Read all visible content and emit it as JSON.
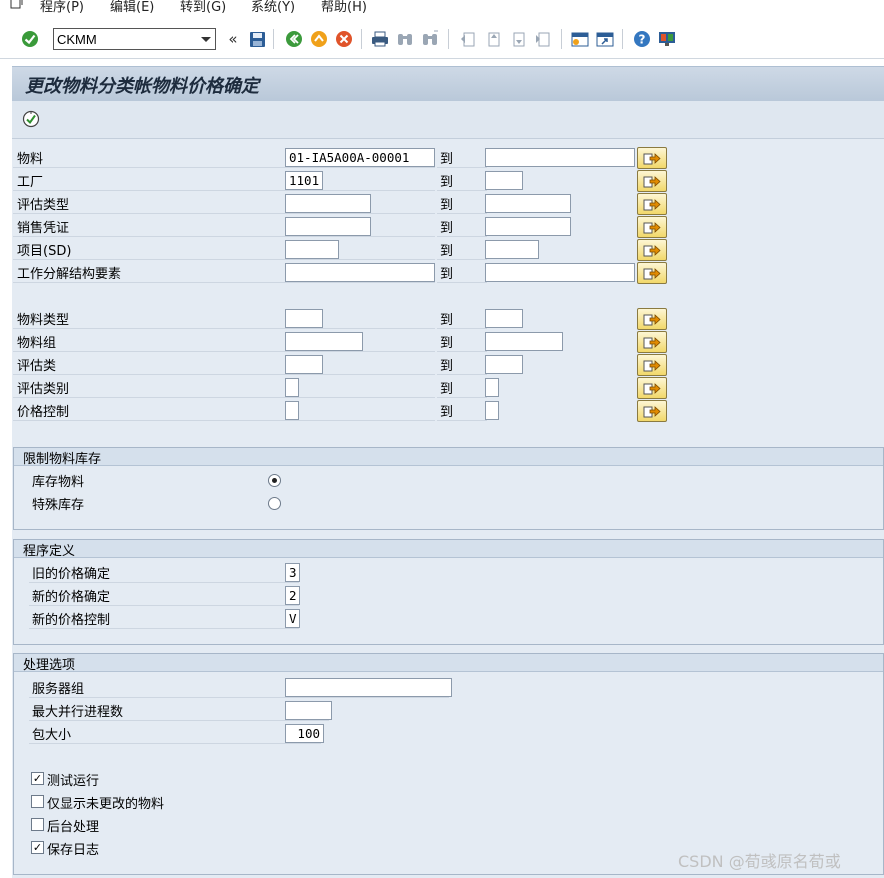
{
  "menu": [
    "程序(P)",
    "编辑(E)",
    "转到(G)",
    "系统(Y)",
    "帮助(H)"
  ],
  "toolbar": {
    "command_value": "CKMM",
    "icons": [
      "ok-icon",
      "back-double-icon",
      "save-icon",
      "back-icon",
      "exit-icon",
      "cancel-icon",
      "print-icon",
      "find-icon",
      "find-next-icon",
      "first-page-icon",
      "prev-page-icon",
      "next-page-icon",
      "last-page-icon",
      "new-session-icon",
      "shortcut-icon",
      "help-icon",
      "layout-icon"
    ]
  },
  "title": "更改物料分类帐物料价格确定",
  "selection": {
    "to_label": "到",
    "rows": [
      {
        "label": "物料",
        "from": "01-IA5A00A-00001",
        "to": ""
      },
      {
        "label": "工厂",
        "from": "1101",
        "to": ""
      },
      {
        "label": "评估类型",
        "from": "",
        "to": ""
      },
      {
        "label": "销售凭证",
        "from": "",
        "to": ""
      },
      {
        "label": "项目(SD)",
        "from": "",
        "to": ""
      },
      {
        "label": "工作分解结构要素",
        "from": "",
        "to": ""
      },
      {
        "label": "物料类型",
        "from": "",
        "to": ""
      },
      {
        "label": "物料组",
        "from": "",
        "to": ""
      },
      {
        "label": "评估类",
        "from": "",
        "to": ""
      },
      {
        "label": "评估类别",
        "from": "",
        "to": ""
      },
      {
        "label": "价格控制",
        "from": "",
        "to": ""
      }
    ]
  },
  "stock_group": {
    "title": "限制物料库存",
    "options": [
      {
        "label": "库存物料",
        "selected": true
      },
      {
        "label": "特殊库存",
        "selected": false
      }
    ]
  },
  "program_group": {
    "title": "程序定义",
    "fields": [
      {
        "label": "旧的价格确定",
        "value": "3"
      },
      {
        "label": "新的价格确定",
        "value": "2"
      },
      {
        "label": "新的价格控制",
        "value": "V"
      }
    ]
  },
  "processing_group": {
    "title": "处理选项",
    "fields": [
      {
        "label": "服务器组",
        "value": ""
      },
      {
        "label": "最大并行进程数",
        "value": ""
      },
      {
        "label": "包大小",
        "value": "100"
      }
    ],
    "checkboxes": [
      {
        "label": "测试运行",
        "checked": true
      },
      {
        "label": "仅显示未更改的物料",
        "checked": false
      },
      {
        "label": "后台处理",
        "checked": false
      },
      {
        "label": "保存日志",
        "checked": true
      }
    ]
  },
  "watermark": "CSDN @荀彧原名荀或",
  "colors": {
    "accent_button": "#f2d86a",
    "panel": "#e4ebf3",
    "title_bar": "#c4d2e1"
  }
}
